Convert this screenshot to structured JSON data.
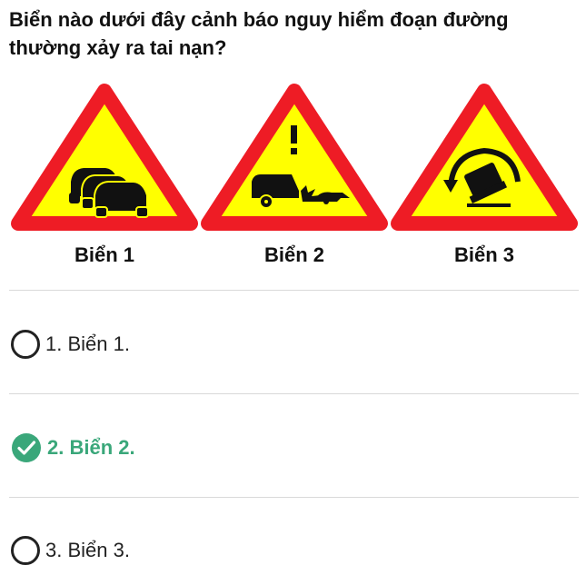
{
  "question": {
    "text": "Biển nào dưới đây cảnh báo nguy hiểm đoạn đường thường xảy ra tai nạn?"
  },
  "signs": [
    {
      "label": "Biển 1",
      "icon": "traffic-queue-warning-sign-icon"
    },
    {
      "label": "Biển 2",
      "icon": "accident-prone-warning-sign-icon"
    },
    {
      "label": "Biển 3",
      "icon": "vehicle-rollover-warning-sign-icon"
    }
  ],
  "options": [
    {
      "text": "1. Biển 1.",
      "state": "unselected"
    },
    {
      "text": "2. Biển 2.",
      "state": "correct"
    },
    {
      "text": "3. Biển 3.",
      "state": "unselected"
    }
  ],
  "colors": {
    "sign_border": "#ee1c25",
    "sign_fill": "#ffff00",
    "correct": "#3aa77a",
    "divider": "#d9d9d9"
  }
}
